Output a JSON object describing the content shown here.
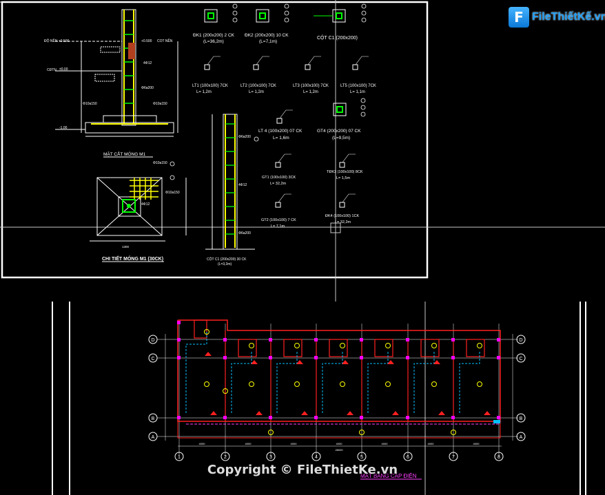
{
  "brand": {
    "logo_glyph": "F",
    "logo_text": "FileThiếtKế.vn",
    "accent": "#1e9ef5"
  },
  "watermark": "Copyright © FileThietKe.vn",
  "sheet1": {
    "section_title": "MẶT CẮT MÓNG M1",
    "detail_title": "CHI TIẾT MÓNG M1 (30CK)",
    "column_title": "CỘT C1 (200x200) 30 CK",
    "column_length": "(L=3,3m)",
    "lbl_nen": "ĐỘ NỀN +0.500",
    "lbl_cot_nen": "COT NỀN",
    "lbl_0500": "+0.500",
    "lbl_dtn": "CĐTN",
    "lbl_000": "±0.00",
    "lbl_100": "-1.00",
    "rebar_a": "4Φ12",
    "rebar_b": "Φ6a200",
    "rebar_c": "Φ10a150",
    "rebar_d": "Φ6a200",
    "dims": [
      "1000",
      "1000",
      "3000",
      "1300",
      "200"
    ]
  },
  "schedule": [
    {
      "name": "ĐK1 (200x200) 2 CK",
      "len": "(L=36,2m)"
    },
    {
      "name": "ĐK2 (200x200) 10 CK",
      "len": "(L=7,1m)"
    },
    {
      "name": "CỘT C1 (200x200)",
      "len": ""
    },
    {
      "name": "LT1 (100x100) 7CK",
      "len": "L= 1,2m"
    },
    {
      "name": "LT2 (100x100) 7CK",
      "len": "L= 1,2m"
    },
    {
      "name": "LT3 (100x100) 7CK",
      "len": "L= 1,2m"
    },
    {
      "name": "LT5 (100x100) 7CK",
      "len": "L= 1,1m"
    },
    {
      "name": "LT 4 (100x200) 07 CK",
      "len": "L= 1,6m"
    },
    {
      "name": "GT4 (200x200) 07 CK",
      "len": "(L=9,5m)"
    },
    {
      "name": "GT1 (100x100) 3CK",
      "len": "L= 32,2m"
    },
    {
      "name": "TĐK3 (100x100) 8CK",
      "len": "L= 1,5m"
    },
    {
      "name": "GT2 (100x100) 7 CK",
      "len": "L= 7,1m"
    },
    {
      "name": "ĐK4 (100x100) 1CK",
      "len": "L= 32,2m"
    }
  ],
  "plan": {
    "title": "MẶT BẰNG CẤP ĐIỆN",
    "axes_numbers": [
      "1",
      "2",
      "3",
      "4",
      "5",
      "6",
      "7",
      "8"
    ],
    "axes_letters": [
      "D",
      "C",
      "B",
      "A"
    ],
    "dim_bottom": [
      "4000",
      "4000",
      "4000",
      "4000",
      "4000",
      "4000",
      "4000"
    ],
    "dim_total": "28000"
  }
}
